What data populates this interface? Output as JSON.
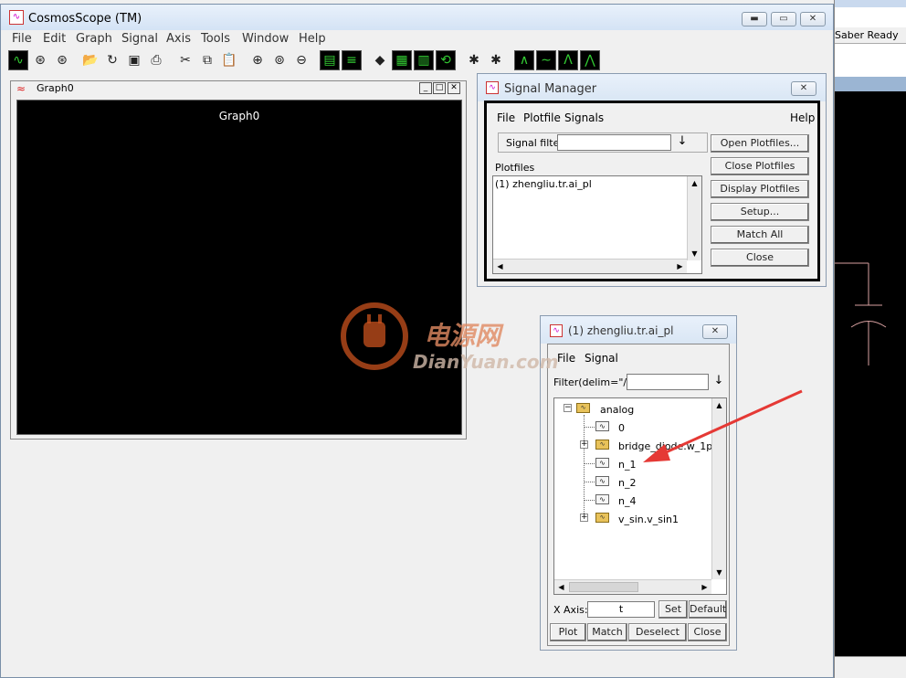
{
  "app": {
    "title": "CosmosScope (TM)",
    "icon": "cosmosscope-app-icon",
    "menu": [
      "File",
      "Edit",
      "Graph",
      "Signal",
      "Axis",
      "Tools",
      "Window",
      "Help"
    ]
  },
  "background_app": {
    "status": "Saber Ready"
  },
  "toolbar": {
    "buttons": [
      "new-graph-icon",
      "open-icon-1",
      "open-icon-2",
      "open-folder-icon",
      "reload-icon",
      "save-icon",
      "print-icon",
      "cut-icon",
      "copy-icon",
      "paste-icon",
      "zoom-in-icon",
      "zoom-fit-icon",
      "zoom-out-icon",
      "stack-icon",
      "bus-icon",
      "erase-icon",
      "grid-icon",
      "bars-icon",
      "cycle-icon",
      "bug-icon",
      "bug-signal-icon",
      "measure-icon-1",
      "measure-icon-2",
      "measure-icon-3",
      "measure-icon-4"
    ]
  },
  "graph_window": {
    "title": "Graph0",
    "canvas_title": "Graph0"
  },
  "signal_manager": {
    "title": "Signal Manager",
    "menu": {
      "file": "File",
      "plotfile": "Plotfile",
      "signals": "Signals",
      "help": "Help"
    },
    "signal_filter_label": "Signal filter",
    "signal_filter_value": "",
    "plotfiles_label": "Plotfiles",
    "plotfiles": [
      "(1) zhengliu.tr.ai_pl"
    ],
    "buttons": {
      "open": "Open Plotfiles...",
      "close_pf": "Close Plotfiles",
      "display": "Display Plotfiles",
      "setup": "Setup...",
      "match_all": "Match All",
      "close": "Close"
    }
  },
  "plotfile_window": {
    "title": "(1) zhengliu.tr.ai_pl",
    "menu": {
      "file": "File",
      "signal": "Signal"
    },
    "filter_label": "Filter(delim=\"/\")",
    "filter_value": "",
    "tree": {
      "root": "analog",
      "children": [
        "0",
        "bridge_diode.w_1p",
        "n_1",
        "n_2",
        "n_4",
        "v_sin.v_sin1"
      ]
    },
    "xaxis_label": "X Axis:",
    "xaxis_value": "t",
    "set": "Set",
    "default": "Default",
    "actions": {
      "plot": "Plot",
      "match": "Match",
      "deselect": "Deselect",
      "close": "Close"
    }
  },
  "watermark": {
    "cn": "电源网",
    "en": "DianYuan.com"
  },
  "colors": {
    "titlebar": "#d9e6f4",
    "graph_bg": "#000000",
    "annotation_arrow": "#e53935",
    "watermark": "#c8521e"
  }
}
